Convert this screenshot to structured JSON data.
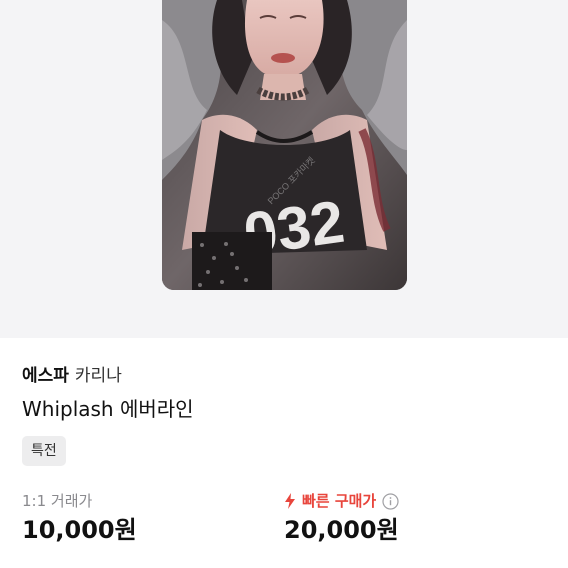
{
  "product": {
    "artist": "에스파",
    "member": "카리나",
    "title": "Whiplash 에버라인",
    "tag": "특전"
  },
  "pricing": {
    "trade_label": "1:1 거래가",
    "trade_price": "10,000원",
    "fast_buy_label": "빠른 구매가",
    "fast_buy_price": "20,000원"
  },
  "photo": {
    "shirt_text": "032",
    "watermark": "POCO 포카마켓"
  },
  "colors": {
    "accent_red": "#e8453c",
    "muted_gray": "#8a8a8e",
    "tag_bg": "#ededee",
    "hero_bg": "#f4f4f6"
  },
  "icons": {
    "fast_buy": "lightning-bolt-icon",
    "info": "info-circle-icon"
  }
}
